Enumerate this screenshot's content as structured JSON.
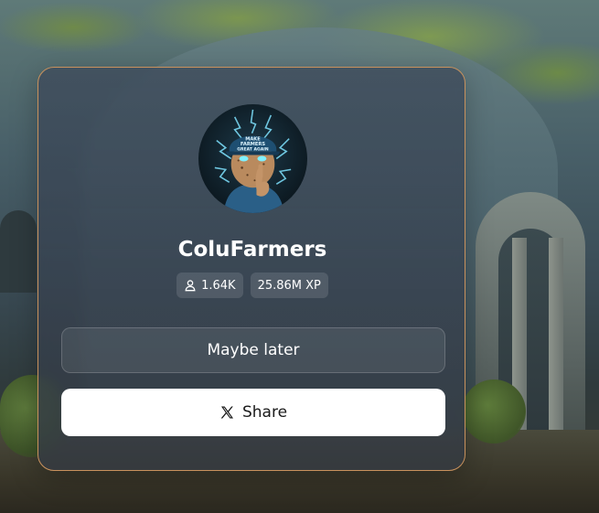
{
  "profile": {
    "username": "ColuFarmers",
    "followers": "1.64K",
    "xp": "25.86M XP",
    "avatar_caption": "MAKE FARMERS GREAT AGAIN"
  },
  "actions": {
    "maybe_later_label": "Maybe later",
    "share_label": "Share"
  },
  "icons": {
    "followers": "user-icon",
    "share": "x-logo-icon"
  },
  "colors": {
    "card_border": "#c9925d",
    "share_button_bg": "#ffffff",
    "text_primary": "#ffffff"
  }
}
